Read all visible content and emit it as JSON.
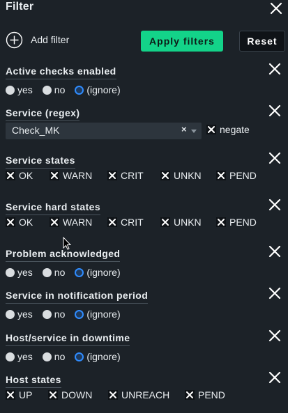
{
  "header": {
    "title": "Filter"
  },
  "toolbar": {
    "add_filter": "Add filter",
    "apply": "Apply filters",
    "reset": "Reset"
  },
  "sections": {
    "active_checks": {
      "title": "Active checks enabled",
      "options": [
        "yes",
        "no",
        "(ignore)"
      ],
      "selected": "(ignore)"
    },
    "service_regex": {
      "title": "Service (regex)",
      "value": "Check_MK",
      "clear": "×",
      "negate": "negate",
      "negate_checked": true
    },
    "service_states": {
      "title": "Service states",
      "options": [
        "OK",
        "WARN",
        "CRIT",
        "UNKN",
        "PEND"
      ]
    },
    "service_hard_states": {
      "title": "Service hard states",
      "options": [
        "OK",
        "WARN",
        "CRIT",
        "UNKN",
        "PEND"
      ]
    },
    "problem_ack": {
      "title": "Problem acknowledged",
      "options": [
        "yes",
        "no",
        "(ignore)"
      ],
      "selected": "(ignore)"
    },
    "notification_period": {
      "title": "Service in notification period",
      "options": [
        "yes",
        "no",
        "(ignore)"
      ],
      "selected": "(ignore)"
    },
    "downtime": {
      "title": "Host/service in downtime",
      "options": [
        "yes",
        "no",
        "(ignore)"
      ],
      "selected": "(ignore)"
    },
    "host_states": {
      "title": "Host states",
      "options": [
        "UP",
        "DOWN",
        "UNREACH",
        "PEND"
      ]
    }
  },
  "colors": {
    "background": "#1c2228",
    "accent": "#13d389",
    "radio_selected": "#2f8cff"
  },
  "icons": {
    "close": "close-icon",
    "add": "plus-circle-icon",
    "check": "x-check-icon"
  }
}
